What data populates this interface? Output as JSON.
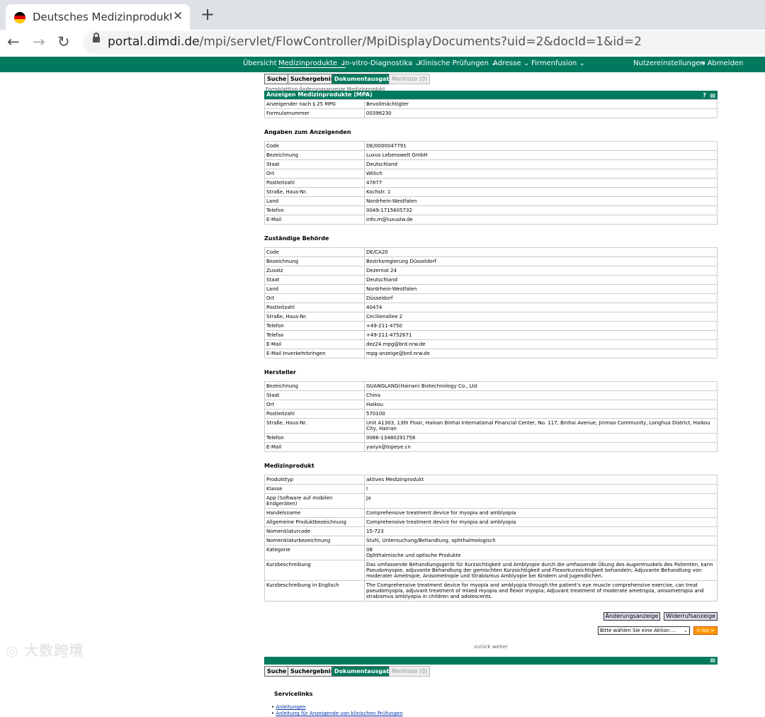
{
  "browser": {
    "tab_title": "Deutsches Medizinprodukte-In",
    "url_host": "portal.dimdi.de",
    "url_path": "/mpi/servlet/FlowController/MpiDisplayDocuments?uid=2&docId=1&id=2"
  },
  "nav": {
    "items": [
      "Übersicht",
      "Medizinprodukte",
      "In-vitro-Diagnostika",
      "Klinische Prüfungen",
      "Adresse",
      "Firmenfusion"
    ],
    "user_settings": "Nutzereinstellungen",
    "logout": "Abmelden"
  },
  "subtabs": [
    "Suche",
    "Suchergebnis",
    "Dokumentausgabe",
    "Merkliste (0)"
  ],
  "cut_row": "Formblatttyp          Änderungsanzeige Medizinprodukt",
  "header": {
    "title": "Anzeigen Medizinprodukte (MPA)",
    "rows": [
      {
        "k": "Anzeigender nach § 25 MPG",
        "v": "Bevollmächtigter"
      },
      {
        "k": "Formularnummer",
        "v": "00396230"
      }
    ]
  },
  "sections": [
    {
      "title": "Angaben zum Anzeigenden",
      "rows": [
        {
          "k": "Code",
          "v": "DE/0000047791"
        },
        {
          "k": "Bezeichnung",
          "v": "Luxus Lebenswelt GmbH"
        },
        {
          "k": "Staat",
          "v": "Deutschland"
        },
        {
          "k": "Ort",
          "v": "Willich"
        },
        {
          "k": "Postleitzahl",
          "v": "47877"
        },
        {
          "k": "Straße, Haus-Nr.",
          "v": "Kochstr. 1"
        },
        {
          "k": "Land",
          "v": "Nordrhein-Westfalen"
        },
        {
          "k": "Telefon",
          "v": "0049-1715605732"
        },
        {
          "k": "E-Mail",
          "v": "info.m@luxuslw.de"
        }
      ]
    },
    {
      "title": "Zuständige Behörde",
      "rows": [
        {
          "k": "Code",
          "v": "DE/CA20"
        },
        {
          "k": "Bezeichnung",
          "v": "Bezirksregierung Düsseldorf"
        },
        {
          "k": "Zusatz",
          "v": "Dezernat 24"
        },
        {
          "k": "Staat",
          "v": "Deutschland"
        },
        {
          "k": "Land",
          "v": "Nordrhein-Westfalen"
        },
        {
          "k": "Ort",
          "v": "Düsseldorf"
        },
        {
          "k": "Postleitzahl",
          "v": "40474"
        },
        {
          "k": "Straße, Haus-Nr.",
          "v": "Cecilienallee 2"
        },
        {
          "k": "Telefon",
          "v": "+49-211-4750"
        },
        {
          "k": "Telefax",
          "v": "+49-211-4752671"
        },
        {
          "k": "E-Mail",
          "v": "dez24.mpg@brd.nrw.de"
        },
        {
          "k": "E-Mail Inverkehrbringen",
          "v": "mpg-anzeige@brd.nrw.de"
        }
      ]
    },
    {
      "title": "Hersteller",
      "rows": [
        {
          "k": "Bezeichnung",
          "v": "GUANGLANG(Hainan) Biotechnology Co., Ltd"
        },
        {
          "k": "Staat",
          "v": "China"
        },
        {
          "k": "Ort",
          "v": "Haikou"
        },
        {
          "k": "Postleitzahl",
          "v": "570100"
        },
        {
          "k": "Straße, Haus-Nr.",
          "v": "Unit A1303, 13th Floor, Hainan Binhai International Financial Center, No. 117, Binhai Avenue, Jinmao Community, Longhua District, Haikou City, Hainan"
        },
        {
          "k": "Telefon",
          "v": "0086-13480291758"
        },
        {
          "k": "E-Mail",
          "v": "yanyx@topeye.cn"
        }
      ]
    },
    {
      "title": "Medizinprodukt",
      "rows": [
        {
          "k": "Produkttyp",
          "v": "aktives Medizinprodukt"
        },
        {
          "k": "Klasse",
          "v": "I"
        },
        {
          "k": "App (Software auf mobilen Endgeräten)",
          "v": "Ja"
        },
        {
          "k": "Handelsname",
          "v": "Comprehensive treatment device for myopia and amblyopia"
        },
        {
          "k": "Allgemeine Produktbezeichnung",
          "v": "Comprehensive treatment device for myopia and amblyopia"
        },
        {
          "k": "Nomenklaturcode",
          "v": "15-723"
        },
        {
          "k": "Nomenklaturbezeichnung",
          "v": "Stuhl, Untersuchung/Behandlung, ophthalmologisch"
        },
        {
          "k": "Kategorie",
          "v": "08\nOphthalmische und optische Produkte"
        },
        {
          "k": "Kurzbeschreibung",
          "v": "Das umfassende Behandlungsgerät für Kurzsichtigkeit und Amblyopie durch die umfassende Übung des Augenmuskels des Patienten, kann Pseudomyopie, adjuvante Behandlung der gemischten Kurzsichtigkeit und Flexorkurzsichtigkeit behandeln; Adjuvante Behandlung von moderater Ametropie, Anisometropie und Strabismus Amblyopie bei Kindern und Jugendlichen."
        },
        {
          "k": "Kurzbeschreibung in Englisch",
          "v": "The Comprehensive treatment device for myopia and amblyopia through the patient's eye muscle comprehensive exercise, can treat pseudomyopia, adjuvant treatment of mixed myopia and flexor myopia; Adjuvant treatment of moderate ametropia, anisometropia and strabismus amblyopia in children and adolescents."
        }
      ]
    }
  ],
  "actions": {
    "change": "Änderungsanzeige",
    "revoke": "Widerrufsanzeige",
    "select": "Bitte wählen Sie eine Aktion ...",
    "go": "> los >"
  },
  "pager": "zurück weiter",
  "service": {
    "title": "Servicelinks",
    "links": [
      "Anleitungen",
      "Anleitung für Anzeigende von klinischen Prüfungen"
    ]
  },
  "watermark": "大数跨境"
}
